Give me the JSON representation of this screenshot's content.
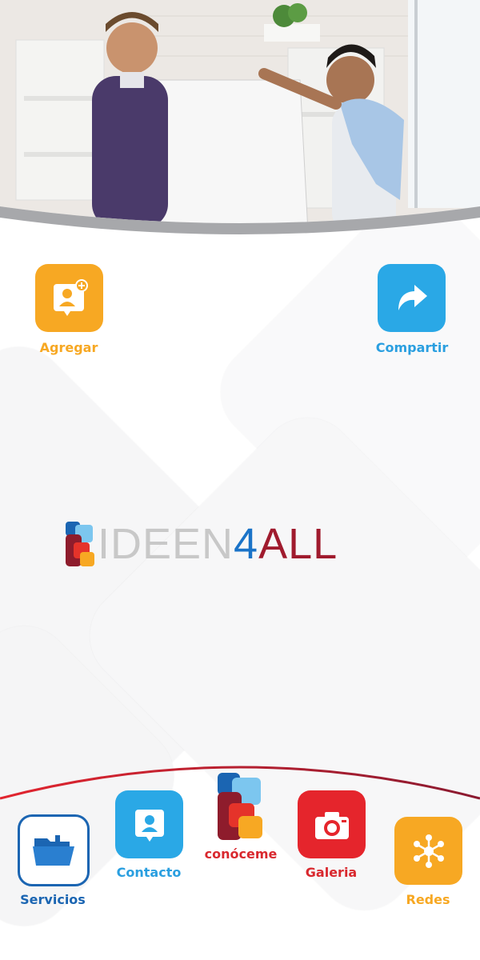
{
  "actions": {
    "agregar": {
      "label": "Agregar",
      "color": "#f7a823"
    },
    "compartir": {
      "label": "Compartir",
      "color": "#2a9fe0"
    }
  },
  "brand": {
    "logo_part1": "IDEEN",
    "logo_part2": "4",
    "logo_part3": "ALL"
  },
  "nav": {
    "servicios": {
      "label": "Servicios",
      "color": "#1b65b2"
    },
    "contacto": {
      "label": "Contacto",
      "color": "#2a9fe0"
    },
    "conoceme": {
      "label": "conóceme",
      "color": "#d9282e"
    },
    "galeria": {
      "label": "Galeria",
      "color": "#d9282e"
    },
    "redes": {
      "label": "Redes",
      "color": "#f7a823"
    }
  }
}
